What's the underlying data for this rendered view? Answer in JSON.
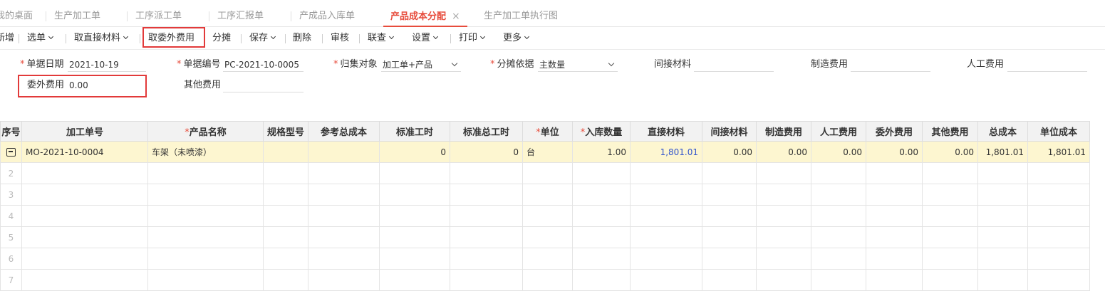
{
  "tabs": [
    {
      "label": "我的桌面"
    },
    {
      "label": "生产加工单"
    },
    {
      "label": "工序派工单"
    },
    {
      "label": "工序汇报单"
    },
    {
      "label": "产成品入库单"
    },
    {
      "label": "产品成本分配",
      "close": "×"
    },
    {
      "label": "生产加工单执行图"
    }
  ],
  "toolbar": {
    "add": "新增",
    "select": "选单",
    "fetch_direct_material": "取直接材料",
    "fetch_outsourcing": "取委外费用",
    "allocate": "分摊",
    "save": "保存",
    "delete": "删除",
    "audit": "审核",
    "link_query": "联查",
    "settings": "设置",
    "print": "打印",
    "more": "更多"
  },
  "form": {
    "doc_date": {
      "label": "单据日期",
      "value": "2021-10-19"
    },
    "doc_no": {
      "label": "单据编号",
      "value": "PC-2021-10-0005"
    },
    "collect_target": {
      "label": "归集对象",
      "value": "加工单+产品"
    },
    "alloc_basis": {
      "label": "分摊依据",
      "value": "主数量"
    },
    "indirect_material": {
      "label": "间接材料",
      "value": ""
    },
    "manufacturing_cost": {
      "label": "制造费用",
      "value": ""
    },
    "labor_cost": {
      "label": "人工费用",
      "value": ""
    },
    "outsourcing_cost": {
      "label": "委外费用",
      "value": "0.00"
    },
    "other_cost": {
      "label": "其他费用",
      "value": ""
    }
  },
  "grid": {
    "headers": [
      "序号",
      "加工单号",
      "产品名称",
      "规格型号",
      "参考总成本",
      "标准工时",
      "标准总工时",
      "单位",
      "入库数量",
      "直接材料",
      "间接材料",
      "制造费用",
      "人工费用",
      "委外费用",
      "其他费用",
      "总成本",
      "单位成本"
    ],
    "rows": [
      {
        "seq": "",
        "order_no": "MO-2021-10-0004",
        "product": "车架（未喷漆）",
        "spec": "",
        "ref_total": "",
        "std_hours": "0",
        "std_total_hours": "0",
        "unit": "台",
        "qty": "1.00",
        "direct_material": "1,801.01",
        "indirect_material": "0.00",
        "mfg_cost": "0.00",
        "labor": "0.00",
        "outsourcing": "0.00",
        "other": "0.00",
        "total_cost": "1,801.01",
        "unit_cost": "1,801.01"
      },
      {
        "seq": "2"
      },
      {
        "seq": "3"
      },
      {
        "seq": "4"
      },
      {
        "seq": "5"
      },
      {
        "seq": "6"
      },
      {
        "seq": "7"
      }
    ]
  },
  "colors": {
    "accent": "#e74c3c",
    "highlight_row": "#fdf6d0",
    "link": "#3355cc"
  }
}
